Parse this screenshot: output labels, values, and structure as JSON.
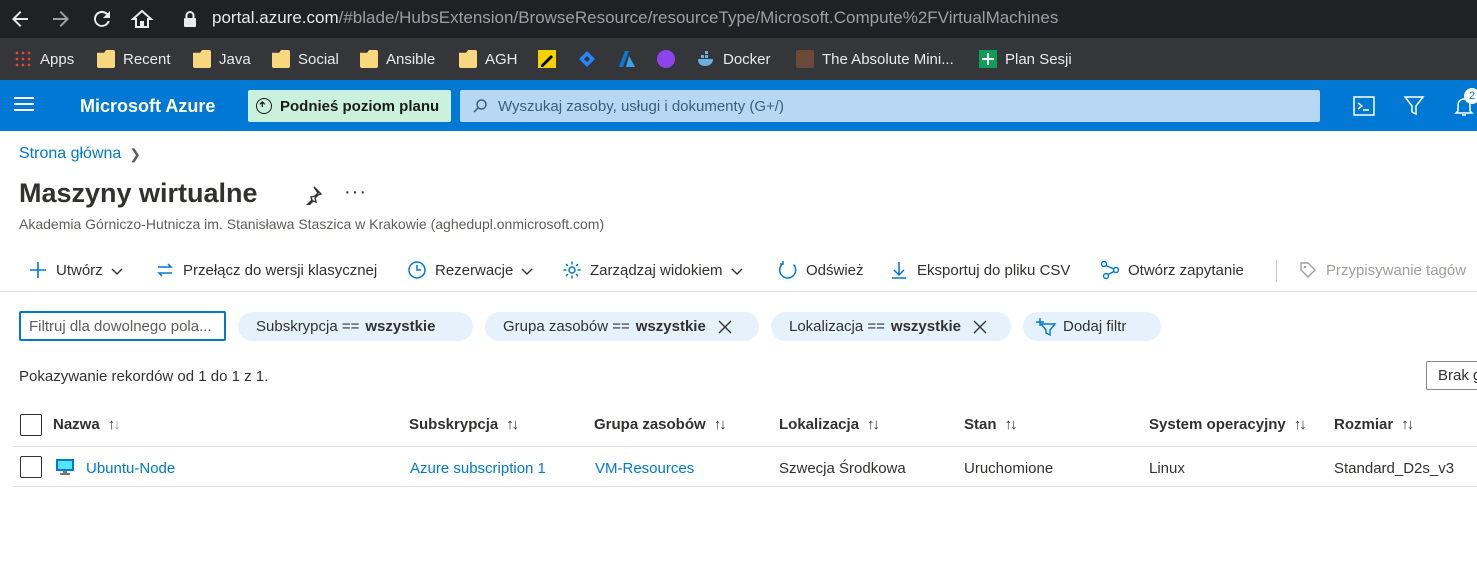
{
  "browser": {
    "url_host": "portal.azure.com",
    "url_path": "/#blade/HubsExtension/BrowseResource/resourceType/Microsoft.Compute%2FVirtualMachines",
    "bookmarks": [
      "Apps",
      "Recent",
      "Java",
      "Social",
      "Ansible",
      "AGH",
      "Docker",
      "The Absolute Mini...",
      "Plan Sesji"
    ]
  },
  "header": {
    "brand": "Microsoft Azure",
    "upgrade_label": "Podnieś poziom planu",
    "search_placeholder": "Wyszukaj zasoby, usługi i dokumenty (G+/)",
    "notification_count": "2"
  },
  "page": {
    "breadcrumb": "Strona główna",
    "title": "Maszyny wirtualne",
    "subtitle": "Akademia Górniczo-Hutnicza im. Stanisława Staszica w Krakowie (aghedupl.onmicrosoft.com)"
  },
  "toolbar": {
    "create": "Utwórz",
    "switch_classic": "Przełącz do wersji klasycznej",
    "reservations": "Rezerwacje",
    "manage_view": "Zarządzaj widokiem",
    "refresh": "Odśwież",
    "export_csv": "Eksportuj do pliku CSV",
    "open_query": "Otwórz zapytanie",
    "assign_tags": "Przypisywanie tagów"
  },
  "filters": {
    "placeholder": "Filtruj dla dowolnego pola...",
    "subscription_label": "Subskrypcja ==",
    "subscription_value": "wszystkie",
    "resource_group_label": "Grupa zasobów ==",
    "resource_group_value": "wszystkie",
    "location_label": "Lokalizacja ==",
    "location_value": "wszystkie",
    "add_filter": "Dodaj filtr"
  },
  "records_text": "Pokazywanie rekordów od 1 do 1 z 1.",
  "grouping_button": "Brak g",
  "table": {
    "columns": [
      "Nazwa",
      "Subskrypcja",
      "Grupa zasobów",
      "Lokalizacja",
      "Stan",
      "System operacyjny",
      "Rozmiar"
    ],
    "rows": [
      {
        "name": "Ubuntu-Node",
        "subscription": "Azure subscription 1",
        "resource_group": "VM-Resources",
        "location": "Szwecja Środkowa",
        "status": "Uruchomione",
        "os": "Linux",
        "size": "Standard_D2s_v3"
      }
    ]
  }
}
